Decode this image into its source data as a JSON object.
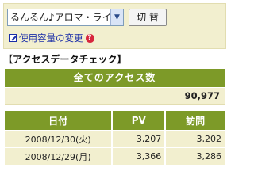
{
  "top_panel": {
    "selected_site": "るんるん♪アロマ・ライフ",
    "switch_label": "切 替",
    "usage_link": "使用容量の変更",
    "help_icon": "?"
  },
  "section_title": "【アクセスデータチェック】",
  "summary": {
    "header": "全てのアクセス数",
    "total": "90,977"
  },
  "daily": {
    "columns": [
      "日付",
      "PV",
      "訪問"
    ],
    "rows": [
      {
        "date": "2008/12/30(火)",
        "pv": "3,207",
        "visits": "3,202"
      },
      {
        "date": "2008/12/29(月)",
        "pv": "3,366",
        "visits": "3,286"
      }
    ]
  },
  "colors": {
    "header_green": "#7d9a28",
    "row_cream": "#f2efcf",
    "link_blue": "#1a2ea8",
    "help_red": "#d7263d"
  },
  "icons": [
    "chevron-down-icon",
    "edit-icon",
    "help-icon"
  ]
}
